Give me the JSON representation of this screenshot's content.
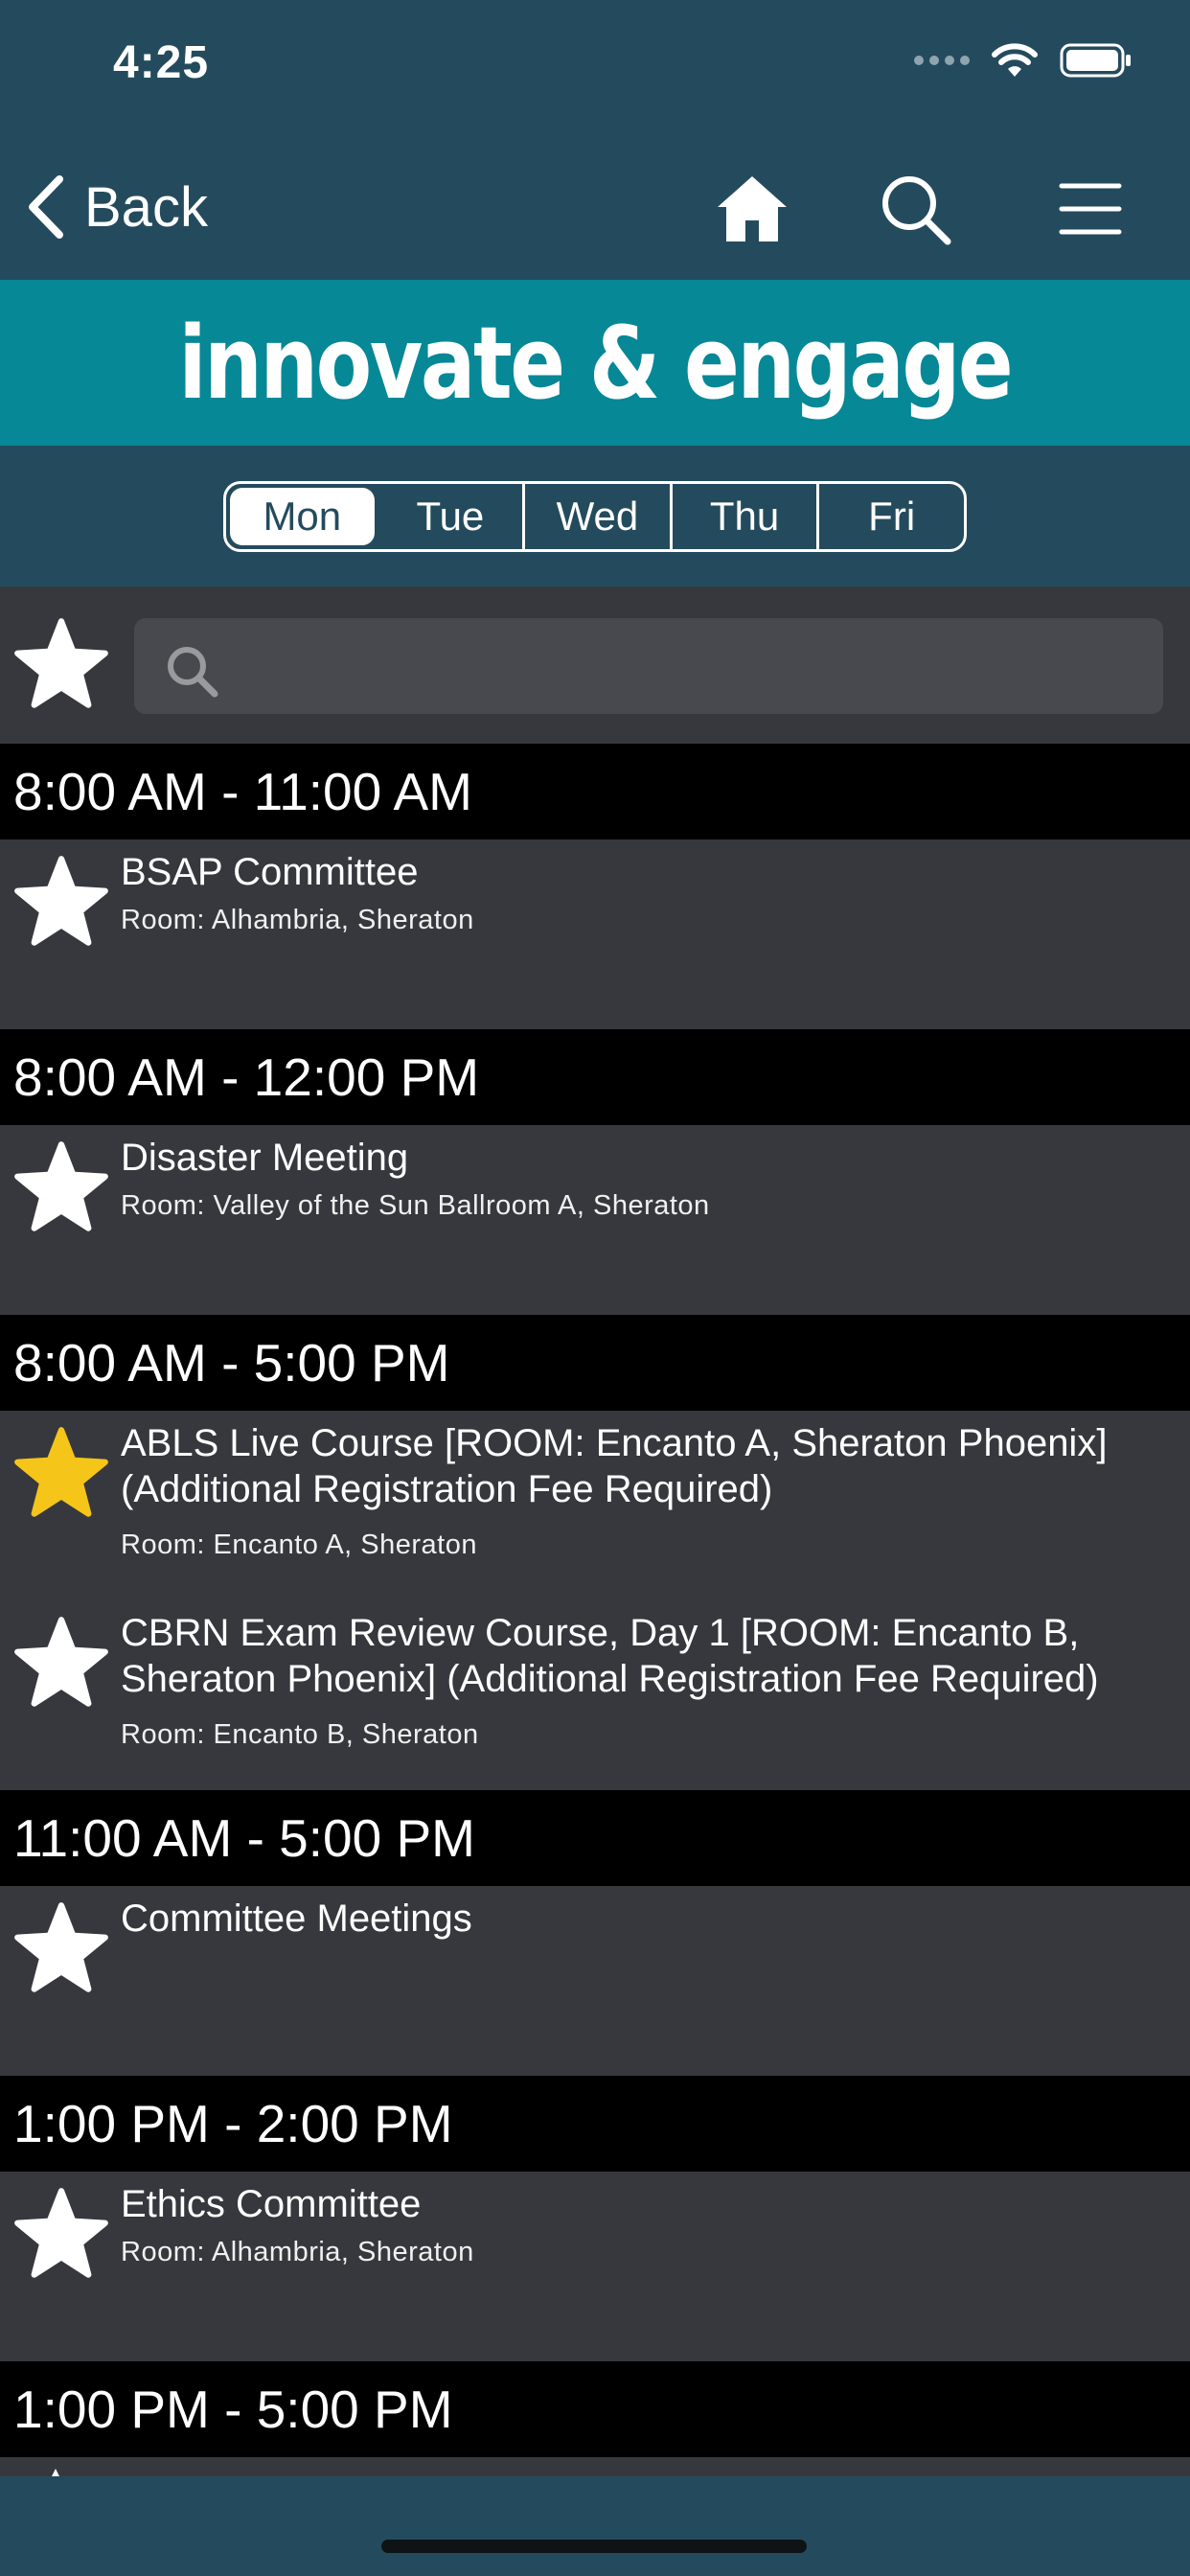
{
  "status_bar": {
    "time": "4:25"
  },
  "nav": {
    "back_label": "Back"
  },
  "banner": {
    "title": "innovate & engage"
  },
  "days": [
    "Mon",
    "Tue",
    "Wed",
    "Thu",
    "Fri"
  ],
  "search": {
    "placeholder": ""
  },
  "colors": {
    "header_bg": "#244b5d",
    "banner_bg": "#068896",
    "list_bg": "#37383d",
    "favorite_star": "#f6c519"
  },
  "schedule": {
    "groups": [
      {
        "time": "8:00 AM - 11:00 AM",
        "sessions": [
          {
            "title": "BSAP Committee",
            "room": "Room: Alhambria, Sheraton"
          }
        ]
      },
      {
        "time": "8:00 AM - 12:00 PM",
        "sessions": [
          {
            "title": "Disaster Meeting",
            "room": "Room: Valley of the Sun Ballroom A, Sheraton"
          }
        ]
      },
      {
        "time": "8:00 AM - 5:00 PM",
        "sessions": [
          {
            "title": "ABLS Live Course [ROOM: Encanto A, Sheraton Phoenix] (Additional Registration Fee Required)",
            "room": "Room: Encanto A, Sheraton"
          },
          {
            "title": "CBRN Exam Review Course, Day 1 [ROOM: Encanto B, Sheraton Phoenix] (Additional Registration Fee Required)",
            "room": "Room: Encanto B, Sheraton"
          }
        ]
      },
      {
        "time": "11:00 AM - 5:00 PM",
        "sessions": [
          {
            "title": "Committee Meetings",
            "room": ""
          }
        ]
      },
      {
        "time": "1:00 PM - 2:00 PM",
        "sessions": [
          {
            "title": "Ethics Committee",
            "room": "Room: Alhambria, Sheraton"
          }
        ]
      },
      {
        "time": "1:00 PM - 5:00 PM",
        "sessions": []
      }
    ]
  }
}
